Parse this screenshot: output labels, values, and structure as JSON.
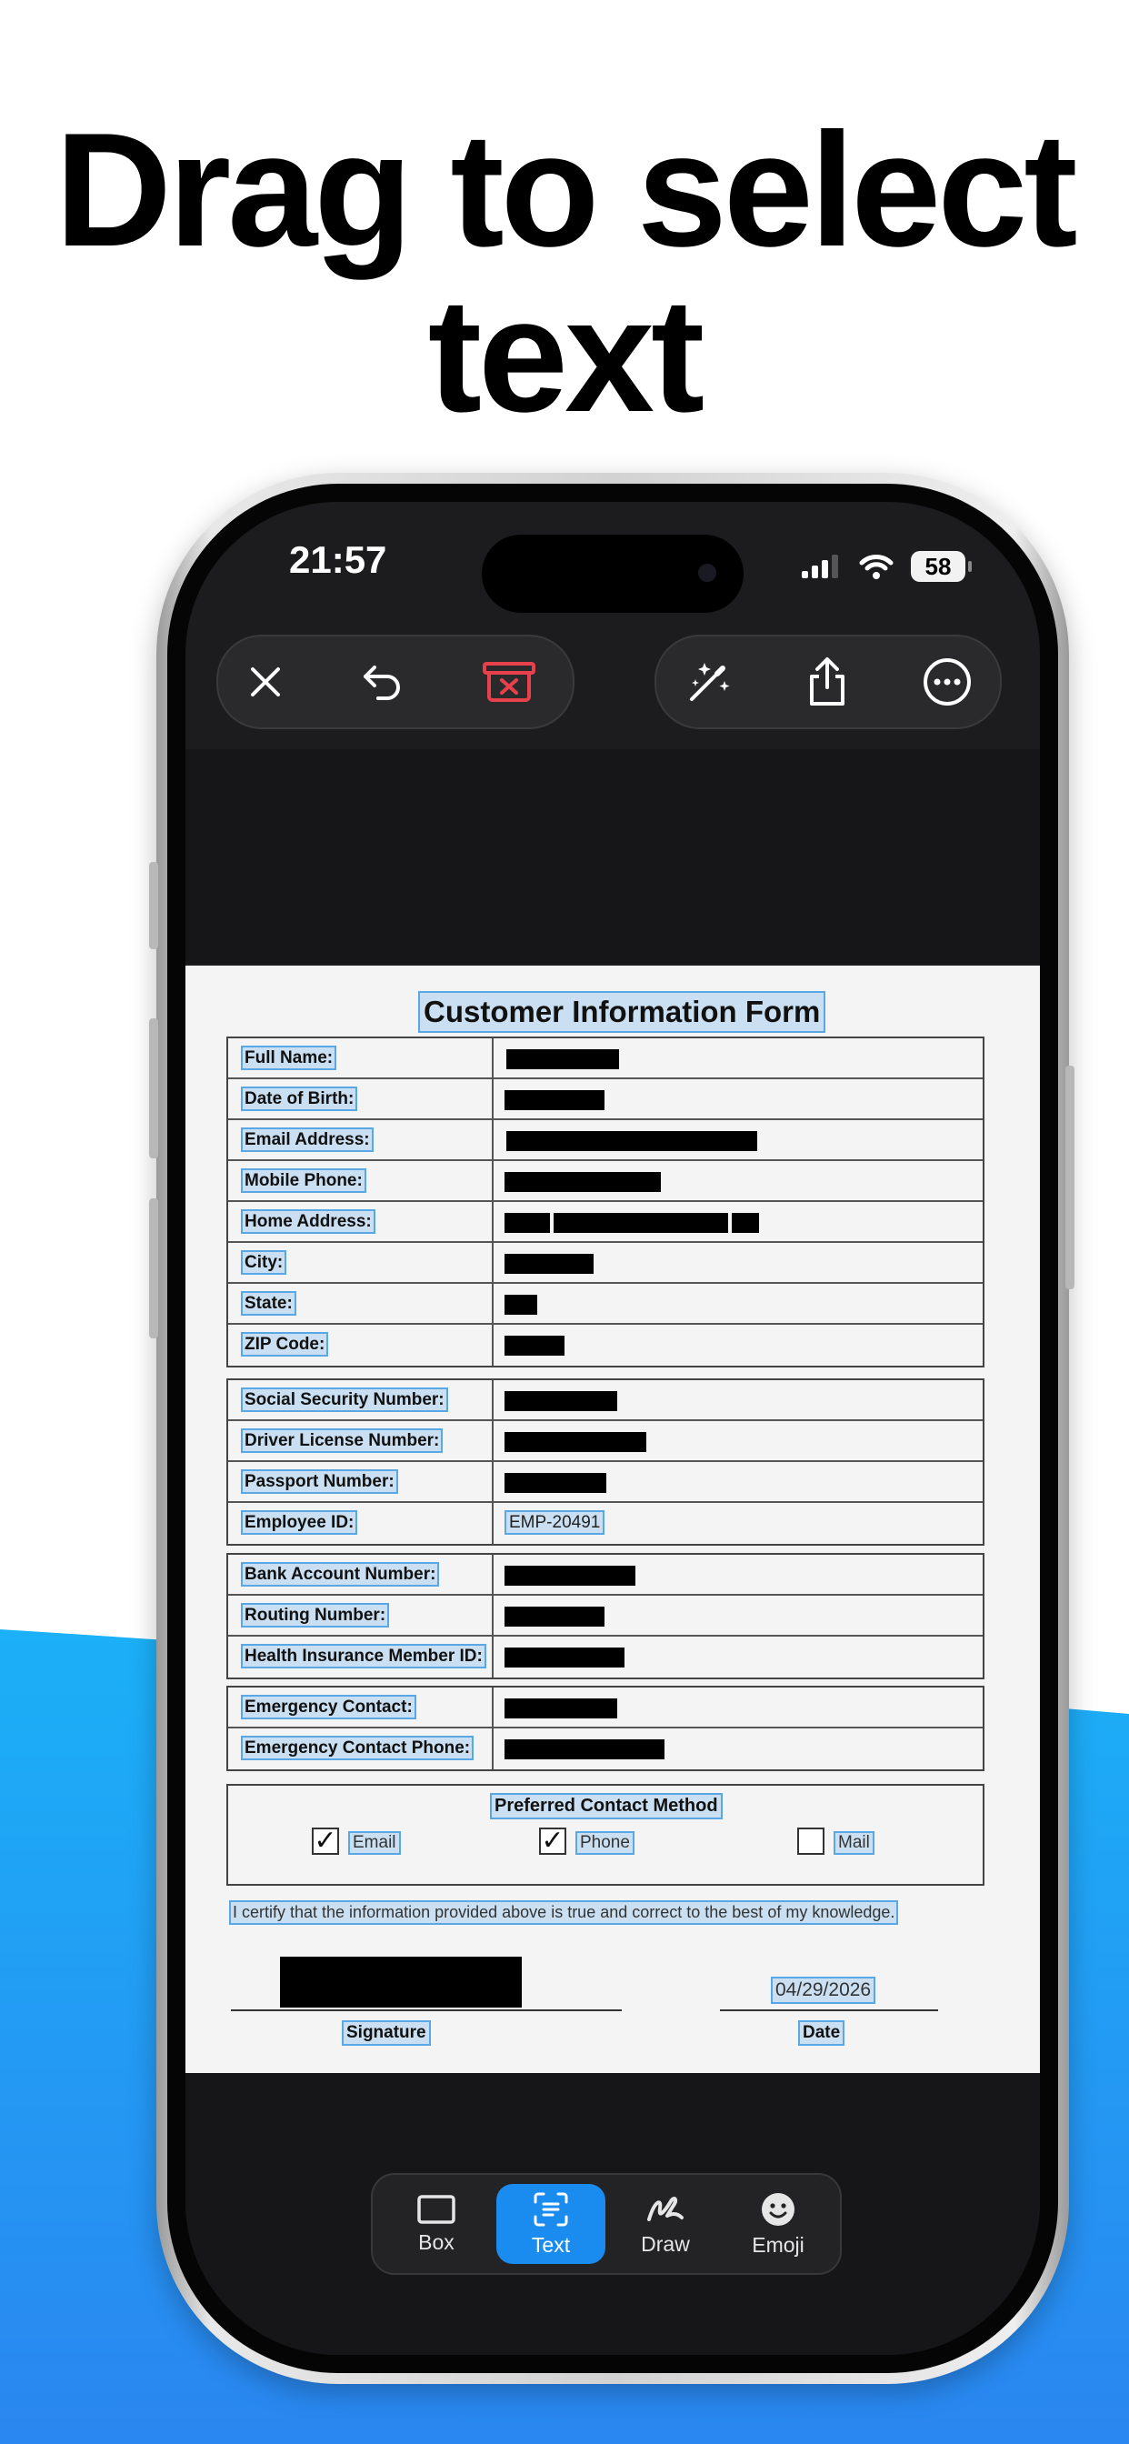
{
  "headline": {
    "line1": "Drag to select",
    "line2": "text"
  },
  "status_bar": {
    "time": "21:57",
    "battery": "58"
  },
  "toolbar": {
    "close_icon": "close-icon",
    "undo_icon": "undo-icon",
    "delete_icon": "trash-icon",
    "magic_icon": "magic-wand-icon",
    "share_icon": "share-icon",
    "more_icon": "more-icon",
    "delete_color": "#e8414b"
  },
  "document": {
    "title": "Customer Information Form",
    "group1": [
      {
        "label": "Full Name:"
      },
      {
        "label": "Date of Birth:"
      },
      {
        "label": "Email Address:"
      },
      {
        "label": "Mobile Phone:"
      },
      {
        "label": "Home Address:"
      },
      {
        "label": "City:"
      },
      {
        "label": "State:"
      },
      {
        "label": "ZIP Code:"
      }
    ],
    "group2": [
      {
        "label": "Social Security Number:"
      },
      {
        "label": "Driver License Number:"
      },
      {
        "label": "Passport Number:"
      },
      {
        "label": "Employee ID:",
        "value": "EMP-20491"
      }
    ],
    "group3": [
      {
        "label": "Bank Account Number:"
      },
      {
        "label": "Routing Number:"
      },
      {
        "label": "Health Insurance Member ID:"
      }
    ],
    "group4": [
      {
        "label": "Emergency Contact:"
      },
      {
        "label": "Emergency Contact Phone:"
      }
    ],
    "contact_method": {
      "title": "Preferred Contact Method",
      "options": [
        {
          "label": "Email",
          "checked": true
        },
        {
          "label": "Phone",
          "checked": true
        },
        {
          "label": "Mail",
          "checked": false
        }
      ]
    },
    "certify": "I certify that the information provided above is true and correct to the best of my knowledge.",
    "signature_caption": "Signature",
    "date_value": "04/29/2026",
    "date_caption": "Date"
  },
  "tabs": [
    {
      "label": "Box",
      "icon": "box-icon",
      "active": false
    },
    {
      "label": "Text",
      "icon": "text-scan-icon",
      "active": true
    },
    {
      "label": "Draw",
      "icon": "draw-icon",
      "active": false
    },
    {
      "label": "Emoji",
      "icon": "emoji-icon",
      "active": false
    }
  ],
  "colors": {
    "accent": "#1a8cf0",
    "background_wave": "#1ea8f5",
    "selection": "#5aa7e6"
  }
}
